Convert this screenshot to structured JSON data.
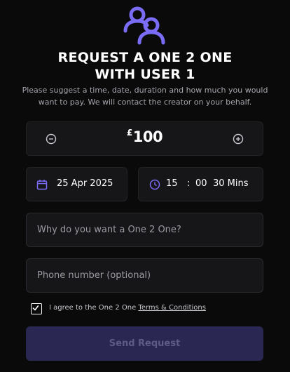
{
  "header": {
    "icon": "users-icon",
    "title_line1": "REQUEST A ONE 2 ONE",
    "title_line2": "WITH USER 1",
    "subtitle": "Please suggest a time, date, duration and how much you would want to pay. We will contact the creator on your behalf."
  },
  "price": {
    "currency": "£",
    "amount": "100",
    "decrement_icon": "minus-circle-icon",
    "increment_icon": "plus-circle-icon"
  },
  "date": {
    "icon": "calendar-icon",
    "value": "25 Apr 2025"
  },
  "time": {
    "icon": "clock-icon",
    "hour": "15",
    "separator": ":",
    "minute": "00",
    "duration": "30 Mins"
  },
  "form": {
    "reason_placeholder": "Why do you want a One 2 One?",
    "phone_placeholder": "Phone number (optional)",
    "agree_text": "I agree to the One 2 One",
    "terms_link": "Terms & Conditions",
    "agree_checked": true,
    "send_label": "Send Request"
  },
  "colors": {
    "accent": "#7b6cf6",
    "background": "#0a0a0b",
    "card": "#161618",
    "send_button_bg": "#2a2752",
    "send_button_text": "#5f5b86"
  }
}
